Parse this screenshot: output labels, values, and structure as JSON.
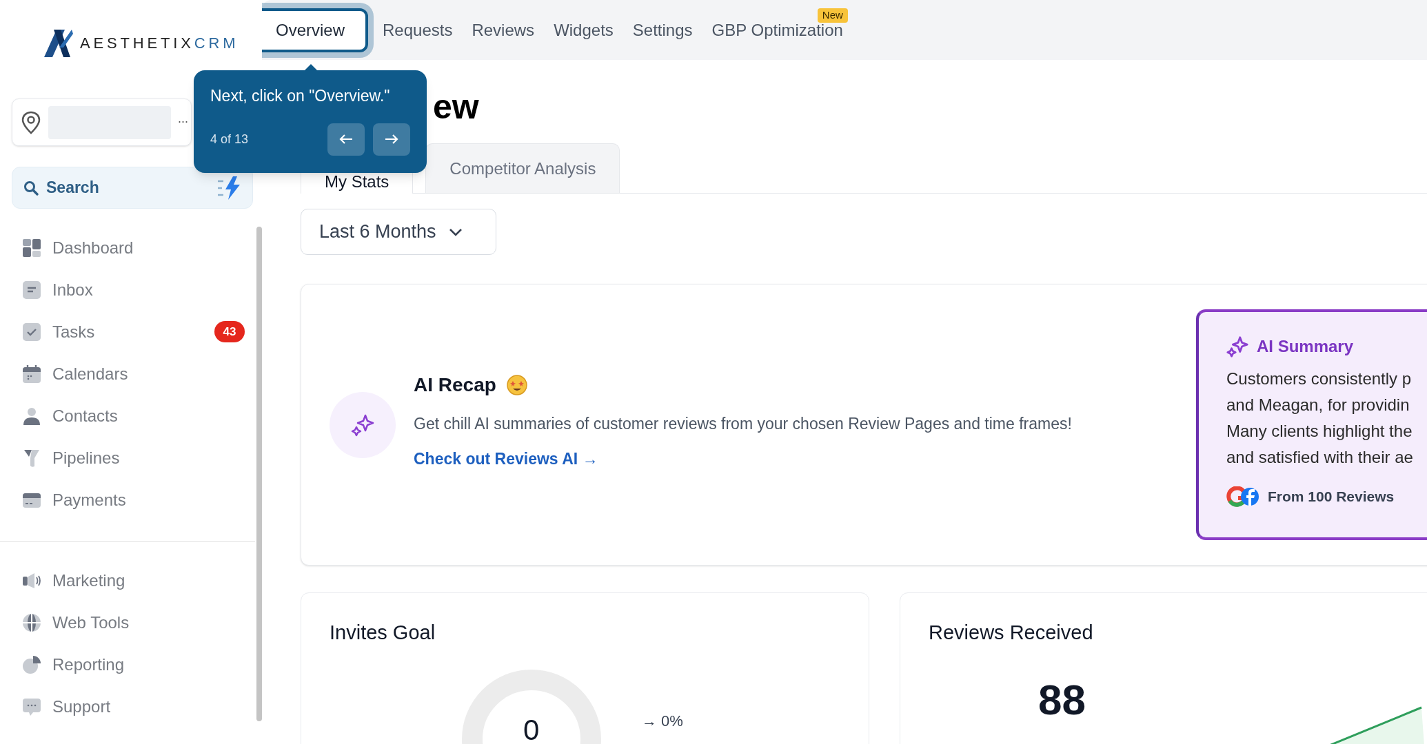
{
  "brand": {
    "name_main": "AESTHETIX",
    "name_accent": "CRM"
  },
  "top_nav": [
    {
      "label": "Overview",
      "selected": true
    },
    {
      "label": "Requests",
      "selected": false
    },
    {
      "label": "Reviews",
      "selected": false
    },
    {
      "label": "Widgets",
      "selected": false
    },
    {
      "label": "Settings",
      "selected": false
    },
    {
      "label": "GBP Optimization",
      "selected": false,
      "badge": "New"
    }
  ],
  "tour_tooltip": {
    "message": "Next, click on \"Overview.\"",
    "step": "4 of 13"
  },
  "sidebar": {
    "location_menu": "...",
    "search": {
      "label": "Search"
    },
    "items": [
      {
        "label": "Dashboard"
      },
      {
        "label": "Inbox"
      },
      {
        "label": "Tasks",
        "badge": "43"
      },
      {
        "label": "Calendars"
      },
      {
        "label": "Contacts"
      },
      {
        "label": "Pipelines"
      },
      {
        "label": "Payments"
      }
    ],
    "items_2": [
      {
        "label": "Marketing"
      },
      {
        "label": "Web Tools"
      },
      {
        "label": "Reporting"
      },
      {
        "label": "Support"
      }
    ]
  },
  "page_title": "ew",
  "sub_tabs": [
    {
      "label": "My Stats",
      "selected": true
    },
    {
      "label": "Competitor Analysis",
      "selected": false
    }
  ],
  "period_select": {
    "value": "Last 6 Months"
  },
  "ai_recap": {
    "title": "AI Recap",
    "description": "Get chill AI summaries of customer reviews from your chosen Review Pages and time frames!",
    "link": "Check out Reviews AI →"
  },
  "ai_summary": {
    "title": "AI Summary",
    "lines": [
      "Customers consistently p",
      "and Meagan, for providin",
      "Many clients highlight the",
      "and satisfied with their ae"
    ],
    "source": "From 100 Reviews"
  },
  "invites_goal": {
    "title": "Invites Goal",
    "value": "0",
    "change": "→ 0%"
  },
  "reviews_received": {
    "title": "Reviews Received",
    "total": "88"
  }
}
